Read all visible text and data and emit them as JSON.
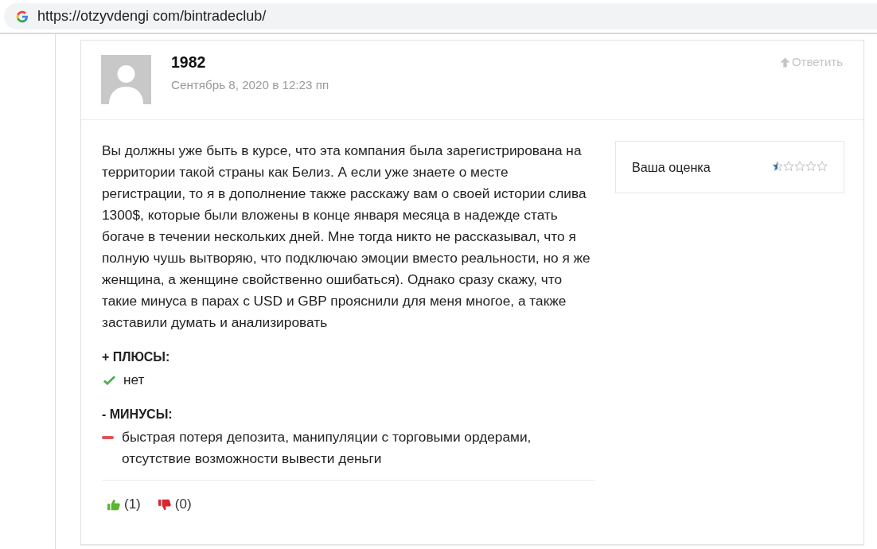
{
  "address_bar": {
    "url": "https://otzyvdengi com/bintradeclub/"
  },
  "review": {
    "author": "1982",
    "date": "Сентябрь 8, 2020 в 12:23 пп",
    "reply_label": "Ответить",
    "text": "Вы должны уже быть в курсе, что эта компания была зарегистрирована на территории такой страны как Белиз. А если уже знаете о месте регистрации, то я в дополнение также расскажу вам о своей истории слива 1300$, которые были вложены в конце января месяца в надежде стать богаче в течении нескольких дней. Мне тогда никто не рассказывал, что я полную чушь вытворяю, что подключаю эмоции вместо реальности, но я же женщина, а женщине свойственно ошибаться). Однако сразу скажу, что такие минуса в парах с USD и GBP прояснили для меня многое, а также заставили думать и анализировать",
    "rating": {
      "label": "Ваша оценка",
      "stars": 0.5
    },
    "sections": [
      {
        "heading": "+ ПЛЮСЫ:",
        "items": [
          {
            "kind": "check",
            "text": "нет"
          }
        ]
      },
      {
        "heading": "- МИНУСЫ:",
        "items": [
          {
            "kind": "minus",
            "text": "быстрая потеря депозита, манипуляции с торговыми ордерами, отсутствие возможности вывести деньги"
          }
        ]
      }
    ],
    "votes": [
      {
        "kind": "up",
        "count": "(1)"
      },
      {
        "kind": "down",
        "count": "(0)"
      }
    ]
  }
}
